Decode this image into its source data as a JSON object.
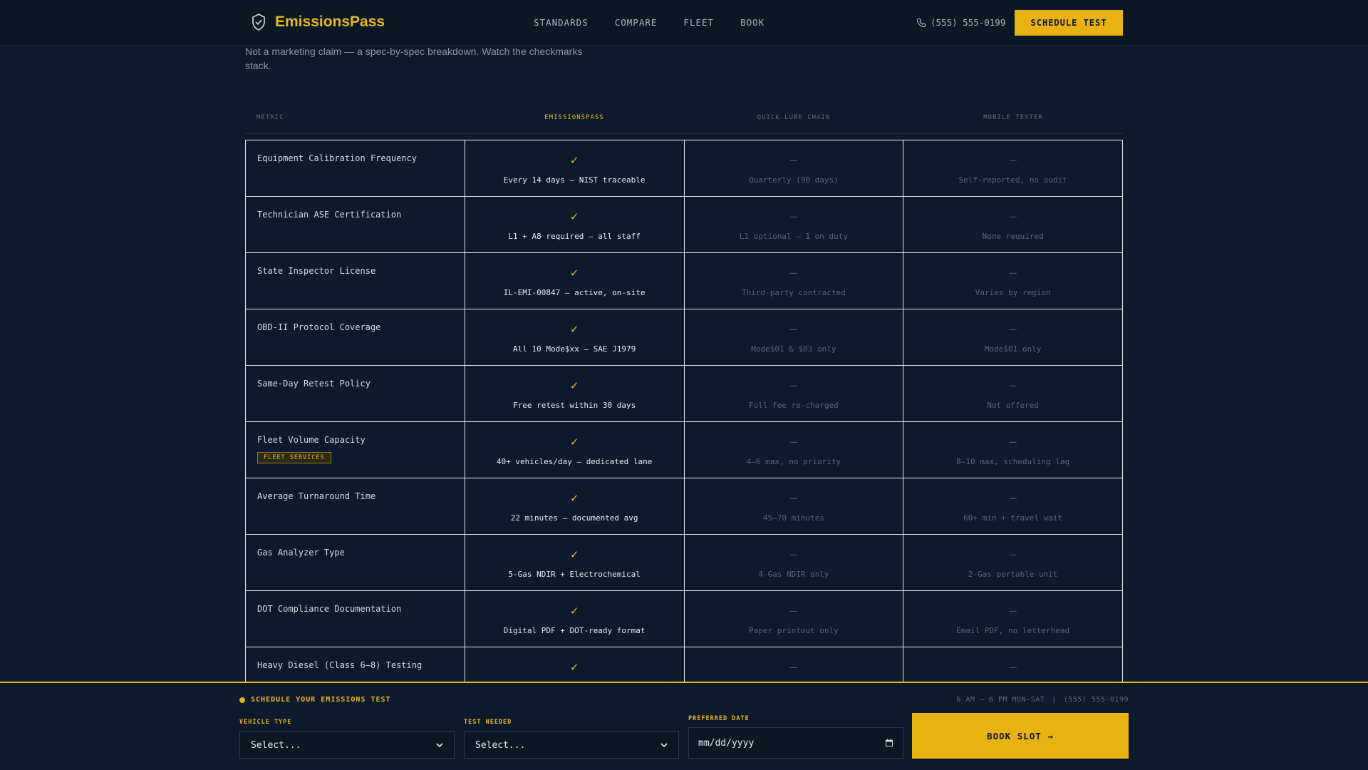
{
  "header": {
    "brand": "EmissionsPass",
    "nav": [
      "STANDARDS",
      "COMPARE",
      "FLEET",
      "BOOK"
    ],
    "phone": "(555) 555-0199",
    "cta": "SCHEDULE TEST"
  },
  "intro": "Not a marketing claim — a spec-by-spec breakdown. Watch the checkmarks stack.",
  "columns": {
    "metric": "METRIC",
    "ep": "EMISSIONSPASS",
    "quick": "QUICK-LUBE CHAIN",
    "mobile": "MOBILE TESTER"
  },
  "rows": [
    {
      "metric": "Equipment Calibration Frequency",
      "ep": "Every 14 days — NIST traceable",
      "quick": "Quarterly (90 days)",
      "mobile": "Self-reported, no audit"
    },
    {
      "metric": "Technician ASE Certification",
      "ep": "L1 + A8 required — all staff",
      "quick": "L1 optional — 1 on duty",
      "mobile": "None required"
    },
    {
      "metric": "State Inspector License",
      "ep": "IL-EMI-00847 — active, on-site",
      "quick": "Third-party contracted",
      "mobile": "Varies by region"
    },
    {
      "metric": "OBD-II Protocol Coverage",
      "ep": "All 10 Mode$xx — SAE J1979",
      "quick": "Mode$01 & $03 only",
      "mobile": "Mode$01 only"
    },
    {
      "metric": "Same-Day Retest Policy",
      "ep": "Free retest within 30 days",
      "quick": "Full fee re-charged",
      "mobile": "Not offered"
    },
    {
      "metric": "Fleet Volume Capacity",
      "badge": "FLEET SERVICES",
      "ep": "40+ vehicles/day — dedicated lane",
      "quick": "4–6 max, no priority",
      "mobile": "8–10 max, scheduling lag"
    },
    {
      "metric": "Average Turnaround Time",
      "ep": "22 minutes — documented avg",
      "quick": "45–70 minutes",
      "mobile": "60+ min + travel wait"
    },
    {
      "metric": "Gas Analyzer Type",
      "ep": "5-Gas NDIR + Electrochemical",
      "quick": "4-Gas NDIR only",
      "mobile": "2-Gas portable unit"
    },
    {
      "metric": "DOT Compliance Documentation",
      "ep": "Digital PDF + DOT-ready format",
      "quick": "Paper printout only",
      "mobile": "Email PDF, no letterhead"
    },
    {
      "metric": "Heavy Diesel (Class 6–8) Testing",
      "ep": "",
      "quick": "",
      "mobile": ""
    }
  ],
  "marks": {
    "yes": "✓",
    "no": "—"
  },
  "booking": {
    "title": "SCHEDULE YOUR EMISSIONS TEST",
    "hours": "6 AM – 6 PM MON–SAT",
    "phone": "(555) 555-0199",
    "vehicle_label": "VEHICLE TYPE",
    "vehicle_value": "Select...",
    "test_label": "TEST NEEDED",
    "test_value": "Select...",
    "date_label": "PREFERRED DATE",
    "date_value": "mm/dd/yyyy",
    "button": "BOOK SLOT →"
  },
  "colors": {
    "accent": "#e8b212",
    "background": "#0c1a2b"
  }
}
